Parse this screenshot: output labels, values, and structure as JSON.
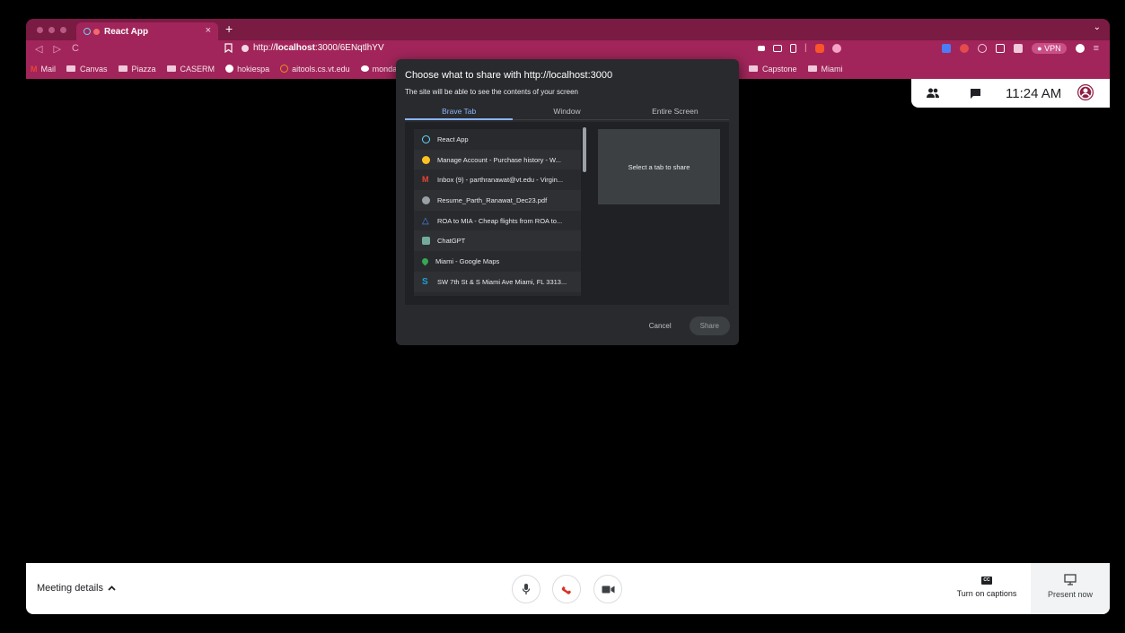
{
  "browser": {
    "tab_title": "React App",
    "tab_close": "×",
    "new_tab": "+",
    "tab_menu": "⌄",
    "nav": [
      "◁",
      "▷",
      "C"
    ],
    "url_prefix": "http://",
    "url_host": "localhost",
    "url_rest": ":3000/6ENqtlhYV",
    "vpn_label": "VPN"
  },
  "bookmarks": {
    "left": [
      {
        "label": "Mail"
      },
      {
        "label": "Canvas"
      },
      {
        "label": "Piazza"
      },
      {
        "label": "CASERM"
      },
      {
        "label": "hokiespa"
      },
      {
        "label": "aitools.cs.vt.edu"
      },
      {
        "label": "monday"
      }
    ],
    "right": [
      {
        "label": "Capstone"
      },
      {
        "label": "Miami"
      }
    ]
  },
  "meet": {
    "clock": "11:24 AM",
    "meeting_details": "Meeting details",
    "captions_icon": "CC",
    "captions_label": "Turn on captions",
    "present_label": "Present now"
  },
  "dialog": {
    "title": "Choose what to share with http://localhost:3000",
    "subtitle": "The site will be able to see the contents of your screen",
    "tabs": [
      "Brave Tab",
      "Window",
      "Entire Screen"
    ],
    "items": [
      {
        "label": "React App",
        "icon": "react-icon",
        "color": "#61dafb"
      },
      {
        "label": "Manage Account - Purchase history - W...",
        "icon": "walmart-spark-icon",
        "color": "#ffc220"
      },
      {
        "label": "Inbox (9) - parthranawat@vt.edu - Virgin...",
        "icon": "gmail-icon",
        "color": "#ea4335"
      },
      {
        "label": "Resume_Parth_Ranawat_Dec23.pdf",
        "icon": "globe-icon",
        "color": "#9aa0a6"
      },
      {
        "label": "ROA to MIA - Cheap flights from ROA to...",
        "icon": "flight-icon",
        "color": "#4d8ef7"
      },
      {
        "label": "ChatGPT",
        "icon": "chatgpt-icon",
        "color": "#74aa9c"
      },
      {
        "label": "Miami - Google Maps",
        "icon": "maps-pin-icon",
        "color": "#34a853"
      },
      {
        "label": "SW 7th St & S Miami Ave Miami, FL 3313...",
        "icon": "s-logo-icon",
        "color": "#1ea0d8"
      }
    ],
    "preview_text": "Select a tab to share",
    "cancel": "Cancel",
    "share": "Share"
  },
  "colors": {
    "browser_accent": "#a1255a",
    "dialog_bg": "#292a2d",
    "active_tab": "#8ab4f8",
    "end_call": "#d93025"
  }
}
